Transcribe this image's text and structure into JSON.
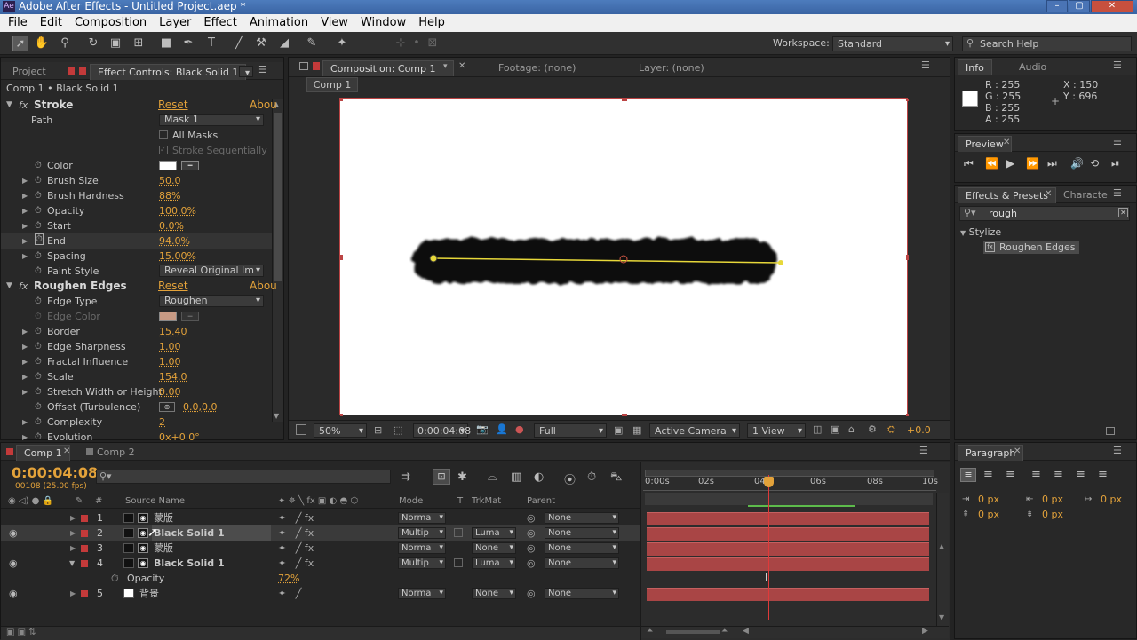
{
  "app": {
    "title": "Adobe After Effects - Untitled Project.aep *",
    "icon": "Ae"
  },
  "menu": [
    "File",
    "Edit",
    "Composition",
    "Layer",
    "Effect",
    "Animation",
    "View",
    "Window",
    "Help"
  ],
  "toolbar": {
    "workspace_label": "Workspace:",
    "workspace_value": "Standard",
    "search_placeholder": "Search Help"
  },
  "left_panel": {
    "tab_project": "Project",
    "tab_effect_controls": "Effect Controls: Black Solid 1",
    "breadcrumb": "Comp 1 • Black Solid 1",
    "stroke": {
      "name": "Stroke",
      "reset": "Reset",
      "about": "Abou",
      "path_label": "Path",
      "path_value": "Mask 1",
      "all_masks": "All Masks",
      "stroke_seq": "Stroke Sequentially",
      "props": [
        {
          "name": "Color",
          "value": ""
        },
        {
          "name": "Brush Size",
          "value": "50.0"
        },
        {
          "name": "Brush Hardness",
          "value": "88%"
        },
        {
          "name": "Opacity",
          "value": "100.0%"
        },
        {
          "name": "Start",
          "value": "0.0%"
        },
        {
          "name": "End",
          "value": "94.0%"
        },
        {
          "name": "Spacing",
          "value": "15.00%"
        },
        {
          "name": "Paint Style",
          "value": "Reveal Original Im"
        }
      ]
    },
    "roughen": {
      "name": "Roughen Edges",
      "reset": "Reset",
      "about": "Abou",
      "props": [
        {
          "name": "Edge Type",
          "value": "Roughen"
        },
        {
          "name": "Edge Color",
          "value": ""
        },
        {
          "name": "Border",
          "value": "15.40"
        },
        {
          "name": "Edge Sharpness",
          "value": "1.00"
        },
        {
          "name": "Fractal Influence",
          "value": "1.00"
        },
        {
          "name": "Scale",
          "value": "154.0"
        },
        {
          "name": "Stretch Width or Height",
          "value": "0.00"
        },
        {
          "name": "Offset (Turbulence)",
          "value": "0.0,0.0"
        },
        {
          "name": "Complexity",
          "value": "2"
        },
        {
          "name": "Evolution",
          "value": "0x+0.0°"
        }
      ]
    }
  },
  "composition": {
    "tab": "Composition: Comp 1",
    "footage": "Footage: (none)",
    "layer": "Layer: (none)",
    "crumb": "Comp 1",
    "zoom": "50%",
    "timecode": "0:00:04:08",
    "resolution": "Full",
    "camera": "Active Camera",
    "views": "1 View",
    "exposure": "+0.0"
  },
  "info": {
    "tab_info": "Info",
    "tab_audio": "Audio",
    "r": "R : 255",
    "g": "G : 255",
    "b": "B : 255",
    "a": "A : 255",
    "x": "X : 150",
    "y": "Y : 696"
  },
  "preview": {
    "tab": "Preview"
  },
  "effects_presets": {
    "tab": "Effects & Presets",
    "tab2": "Characte",
    "search": "rough",
    "category": "Stylize",
    "item": "Roughen Edges"
  },
  "paragraph": {
    "tab": "Paragraph",
    "indent1": "0 px",
    "indent2": "0 px",
    "indent3": "0 px",
    "space1": "0 px",
    "space2": "0 px"
  },
  "timeline": {
    "tab1": "Comp 1",
    "tab2": "Comp 2",
    "timecode": "0:00:04:08",
    "frames": "00108 (25.00 fps)",
    "col_source": "Source Name",
    "col_mode": "Mode",
    "col_t": "T",
    "col_trkmat": "TrkMat",
    "col_parent": "Parent",
    "ruler": [
      "0:00s",
      "02s",
      "04s",
      "06s",
      "08s",
      "10s"
    ],
    "layers": [
      {
        "num": "1",
        "name": "蒙版",
        "mode": "Norma",
        "trk": "",
        "parent": "None"
      },
      {
        "num": "2",
        "name": "Black Solid 1",
        "mode": "Multip",
        "trk": "Luma",
        "parent": "None"
      },
      {
        "num": "3",
        "name": "蒙版",
        "mode": "Norma",
        "trk": "None",
        "parent": "None"
      },
      {
        "num": "4",
        "name": "Black Solid 1",
        "mode": "Multip",
        "trk": "Luma",
        "parent": "None"
      },
      {
        "num": "5",
        "name": "背景",
        "mode": "Norma",
        "trk": "None",
        "parent": "None"
      }
    ],
    "opacity_label": "Opacity",
    "opacity_value": "72%"
  },
  "colors": {
    "accent": "#e3a23a",
    "layer_bar": "#a94545",
    "label_red": "#c33a3a",
    "mask_path": "#e7d83a"
  }
}
